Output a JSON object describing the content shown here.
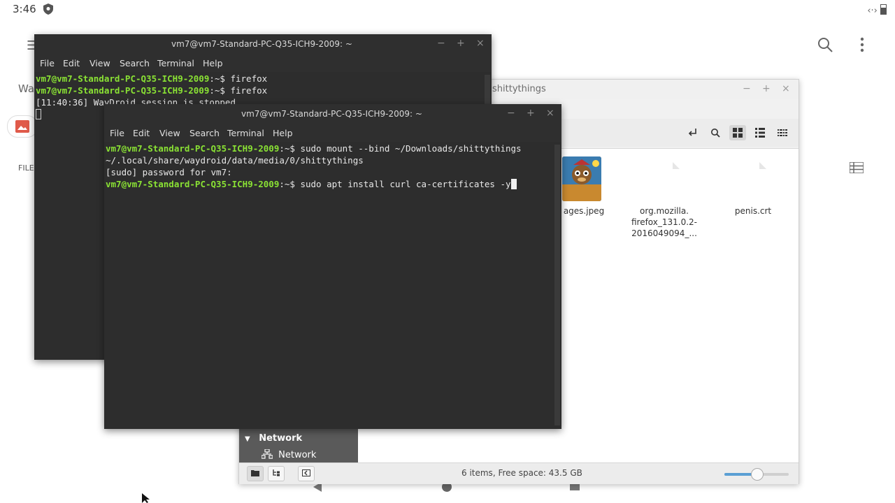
{
  "android": {
    "time": "3:46",
    "bg_app_partial_title": "Wa",
    "bg_app_partial_tab": "FILE"
  },
  "file_manager": {
    "title": "shittythings",
    "files": [
      {
        "name": "ages.jpeg"
      },
      {
        "name": "org.mozilla.\nfirefox_131.0.2-\n2016049094_..."
      },
      {
        "name": "penis.crt"
      }
    ],
    "sidebar": {
      "section": "Network",
      "item": "Network"
    },
    "status": "6 items, Free space: 43.5 GB",
    "zoom_fraction": 0.5
  },
  "terminal_back": {
    "title": "vm7@vm7-Standard-PC-Q35-ICH9-2009: ~",
    "menu": [
      "File",
      "Edit",
      "View",
      "Search",
      "Terminal",
      "Help"
    ],
    "lines": [
      {
        "prompt": "vm7@vm7-Standard-PC-Q35-ICH9-2009",
        "path": ":~$ ",
        "cmd": "firefox"
      },
      {
        "prompt": "vm7@vm7-Standard-PC-Q35-ICH9-2009",
        "path": ":~$ ",
        "cmd": "firefox"
      },
      {
        "prompt": "",
        "path": "",
        "cmd": "[11:40:36] WayDroid session is stopped"
      }
    ]
  },
  "terminal_front": {
    "title": "vm7@vm7-Standard-PC-Q35-ICH9-2009: ~",
    "menu": [
      "File",
      "Edit",
      "View",
      "Search",
      "Terminal",
      "Help"
    ],
    "lines": [
      {
        "prompt": "vm7@vm7-Standard-PC-Q35-ICH9-2009",
        "path": ":~$ ",
        "cmd": "sudo mount --bind ~/Downloads/shittythings"
      },
      {
        "prompt": "",
        "path": "",
        "cmd": "~/.local/share/waydroid/data/media/0/shittythings"
      },
      {
        "prompt": "",
        "path": "",
        "cmd": "[sudo] password for vm7:"
      },
      {
        "prompt": "vm7@vm7-Standard-PC-Q35-ICH9-2009",
        "path": ":~$ ",
        "cmd": "sudo apt install curl ca-certificates -y"
      }
    ]
  },
  "icons": {
    "minimize": "−",
    "maximize": "+",
    "close": "×",
    "hamburger": "☰",
    "sidebar_collapse": "▼"
  },
  "colors": {
    "prompt_green": "#8ae234",
    "terminal_bg": "#2d2d2d",
    "accent_blue": "#5a9fd4"
  }
}
